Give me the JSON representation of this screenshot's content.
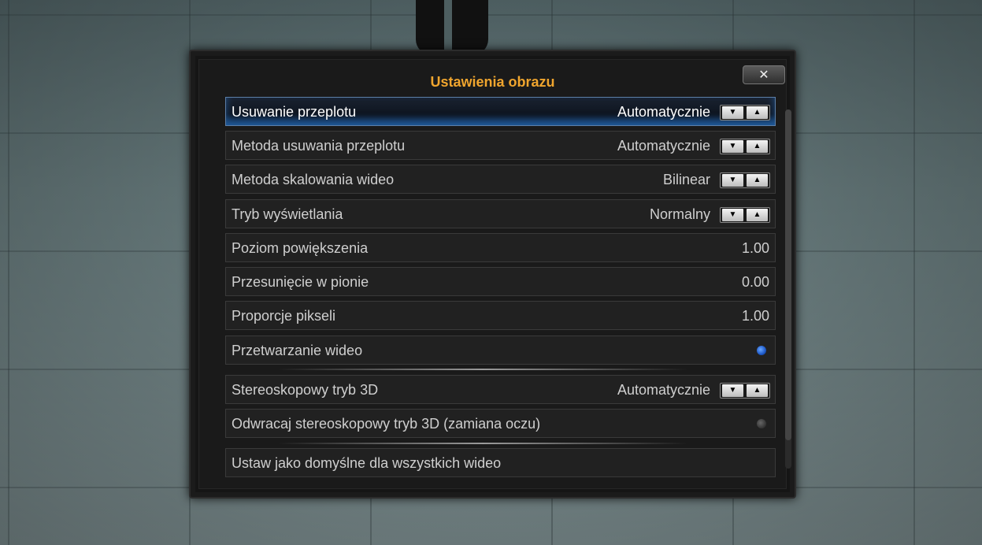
{
  "dialog": {
    "title": "Ustawienia obrazu",
    "close_label": "✕"
  },
  "rows": [
    {
      "label": "Usuwanie przeplotu",
      "value": "Automatycznie",
      "control": "spinner"
    },
    {
      "label": "Metoda usuwania przeplotu",
      "value": "Automatycznie",
      "control": "spinner"
    },
    {
      "label": "Metoda skalowania wideo",
      "value": "Bilinear",
      "control": "spinner"
    },
    {
      "label": "Tryb wyświetlania",
      "value": "Normalny",
      "control": "spinner"
    },
    {
      "label": "Poziom powiększenia",
      "value": "1.00",
      "control": "number"
    },
    {
      "label": "Przesunięcie w pionie",
      "value": "0.00",
      "control": "number"
    },
    {
      "label": "Proporcje pikseli",
      "value": "1.00",
      "control": "number"
    },
    {
      "label": "Przetwarzanie wideo",
      "value": null,
      "control": "radio",
      "checked": true
    },
    {
      "label": "Stereoskopowy tryb 3D",
      "value": "Automatycznie",
      "control": "spinner"
    },
    {
      "label": "Odwracaj stereoskopowy tryb 3D (zamiana oczu)",
      "value": null,
      "control": "radio",
      "checked": false
    },
    {
      "label": "Ustaw jako domyślne dla wszystkich wideo",
      "value": null,
      "control": "button"
    }
  ],
  "spinner": {
    "down": "▼",
    "up": "▲"
  },
  "colors": {
    "accent": "#f0a52e",
    "focus": "#1d58c8"
  }
}
